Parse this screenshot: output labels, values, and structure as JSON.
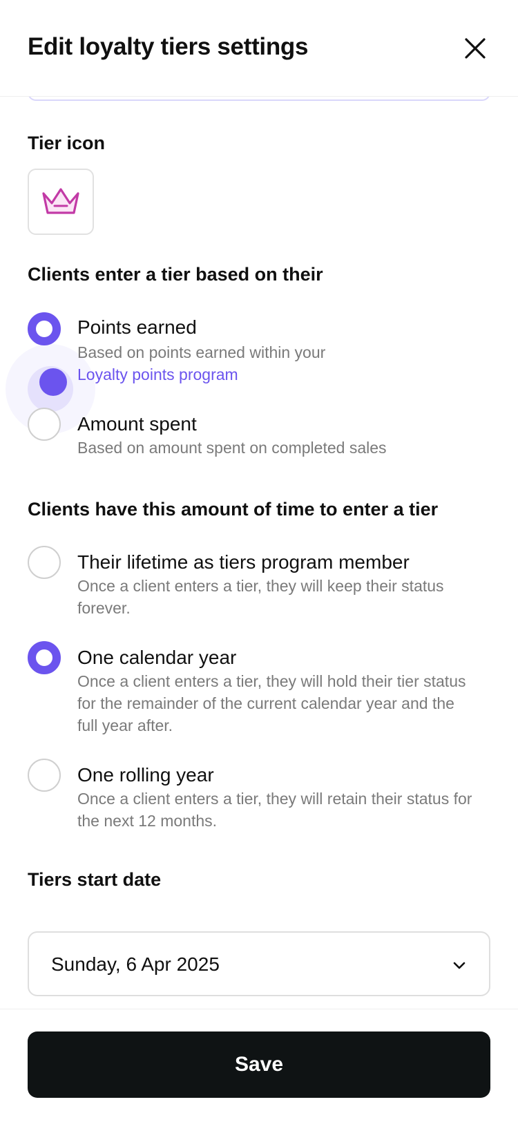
{
  "header": {
    "title": "Edit loyalty tiers settings"
  },
  "tier_icon": {
    "label": "Tier icon"
  },
  "enter_basis": {
    "heading": "Clients enter a tier based on their",
    "options": [
      {
        "title": "Points earned",
        "desc_prefix": "Based on points earned within your",
        "link": "Loyalty points program",
        "selected": true
      },
      {
        "title": "Amount spent",
        "desc": "Based on amount spent on completed sales",
        "selected": false
      }
    ]
  },
  "time_window": {
    "heading": "Clients have this amount of time to enter a tier",
    "options": [
      {
        "title": "Their lifetime as tiers program member",
        "desc": "Once a client enters a tier, they will keep their status forever.",
        "selected": false
      },
      {
        "title": "One calendar year",
        "desc": "Once a client enters a tier, they will hold their tier status for the remainder of the current calendar year and the full year after.",
        "selected": true
      },
      {
        "title": "One rolling year",
        "desc": "Once a client enters a tier, they will retain their status for the next 12 months.",
        "selected": false
      }
    ]
  },
  "start_date": {
    "label": "Tiers start date",
    "value": "Sunday, 6 Apr 2025"
  },
  "footer": {
    "save_label": "Save"
  },
  "colors": {
    "accent": "#6b54ee",
    "icon": "#c23aa6",
    "button": "#0f1314"
  }
}
